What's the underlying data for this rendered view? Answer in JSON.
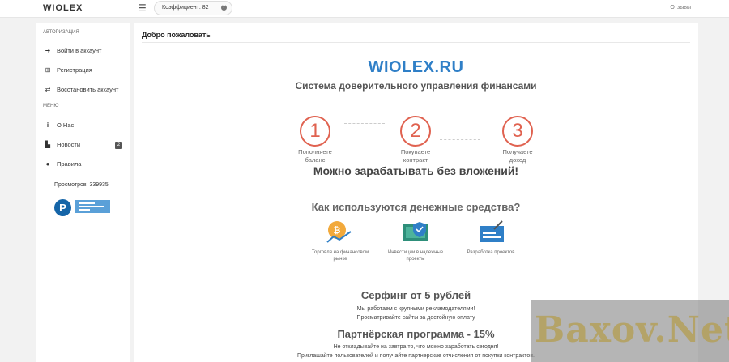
{
  "header": {
    "logo": "WIOLEX",
    "coefficient": "Коэффициент: 82",
    "reviews": "Отзывы"
  },
  "sidebar": {
    "auth_heading": "АВТОРИЗАЦИЯ",
    "login": "Войти в аккаунт",
    "register": "Регистрация",
    "restore": "Восстановить аккаунт",
    "menu_heading": "МЕНЮ",
    "about": "О Нас",
    "news": "Новости",
    "news_badge": "2",
    "rules": "Правила",
    "views": "Просмотров: 339935"
  },
  "main": {
    "title": "Добро пожаловать",
    "brand": "WIOLEX.RU",
    "tagline": "Система доверительного управления финансами",
    "steps": [
      {
        "num": "1",
        "line1": "Пополняете",
        "line2": "баланс"
      },
      {
        "num": "2",
        "line1": "Покупаете",
        "line2": "контракт"
      },
      {
        "num": "3",
        "line1": "Получаете",
        "line2": "доход"
      }
    ],
    "no_investment": "Можно зарабатывать без вложений!",
    "funds_title": "Как используются денежные средства?",
    "funds": [
      {
        "icon": "bitcoin-chart-icon",
        "line1": "Торговля на финансовом",
        "line2": "рынке"
      },
      {
        "icon": "shield-laptop-icon",
        "line1": "Инвестиции в надежные",
        "line2": "проекты"
      },
      {
        "icon": "design-icon",
        "line1": "Разработка проектов",
        "line2": ""
      }
    ],
    "surfing_title": "Серфинг от 5 рублей",
    "surfing_line1": "Мы работаем с крупными рекламодателями!",
    "surfing_line2": "Просматривайте сайты за достойную оплату",
    "partner_title": "Партнёрская программа - 15%",
    "partner_line1": "Не откладывайте на завтра то, что можно заработать сегодня!",
    "partner_line2": "Приглашайте пользователей и получайте партнерские отчисления от покупки контрактов."
  },
  "watermark": "Baxov.Net",
  "colors": {
    "brand": "#2f7fc7",
    "step": "#e06250",
    "bitcoin": "#f2a93b"
  }
}
